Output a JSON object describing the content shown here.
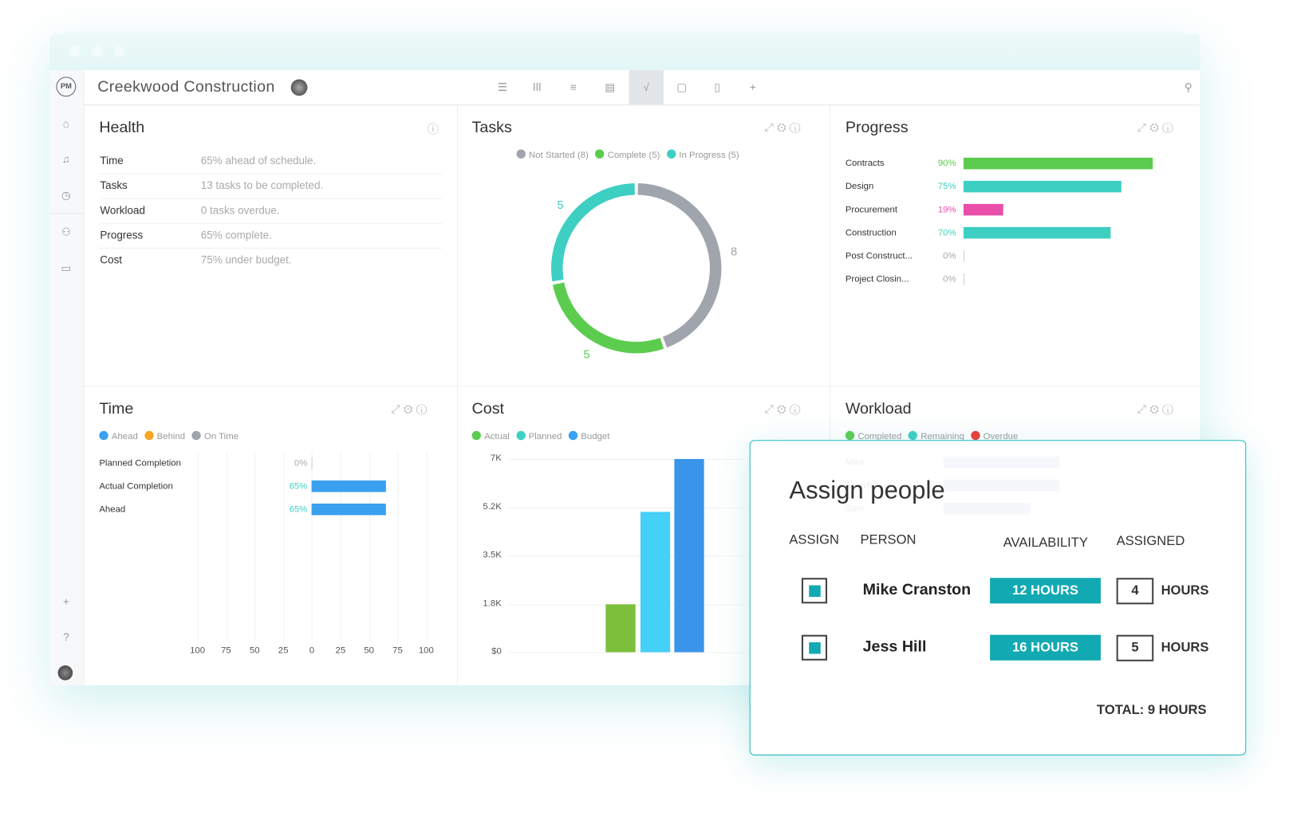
{
  "app": {
    "title": "Creekwood Construction",
    "logo": "PM"
  },
  "toolbar": {
    "icons": [
      "list-icon",
      "board-icon",
      "gantt-icon",
      "sheet-icon",
      "dashboard-icon",
      "calendar-icon",
      "file-icon",
      "plus-icon"
    ],
    "active": "dashboard-icon",
    "search": "search-icon"
  },
  "sidebar": {
    "icons": [
      "home-icon",
      "bell-icon",
      "clock-icon",
      "people-icon",
      "briefcase-icon",
      "plus-icon",
      "help-icon",
      "avatar"
    ]
  },
  "health": {
    "title": "Health",
    "rows": [
      {
        "label": "Time",
        "value": "65% ahead of schedule."
      },
      {
        "label": "Tasks",
        "value": "13 tasks to be completed."
      },
      {
        "label": "Workload",
        "value": "0 tasks overdue."
      },
      {
        "label": "Progress",
        "value": "65% complete."
      },
      {
        "label": "Cost",
        "value": "75% under budget."
      }
    ]
  },
  "tasks": {
    "title": "Tasks",
    "legend": [
      "Not Started (8)",
      "Complete (5)",
      "In Progress (5)"
    ]
  },
  "progress": {
    "title": "Progress"
  },
  "time": {
    "title": "Time",
    "legend": [
      "Ahead",
      "Behind",
      "On Time"
    ]
  },
  "cost": {
    "title": "Cost",
    "legend": [
      "Actual",
      "Planned",
      "Budget"
    ]
  },
  "workload": {
    "title": "Workload",
    "legend": [
      "Completed",
      "Remaining",
      "Overdue"
    ],
    "names": [
      "Mike",
      "Jennifer",
      "Sam"
    ]
  },
  "colors": {
    "teal": "#3ecfc3",
    "green": "#5ccc4e",
    "grey": "#a0a4ad",
    "pink": "#e94faa",
    "blue": "#3aa0f0",
    "accent": "#12a9b2"
  },
  "chart_data": [
    {
      "type": "pie",
      "title": "Tasks",
      "categories": [
        "Not Started",
        "Complete",
        "In Progress"
      ],
      "values": [
        8,
        5,
        5
      ],
      "colors": [
        "#a0a4ad",
        "#5ccc4e",
        "#3ecfc3"
      ],
      "labels": [
        "8",
        "5",
        "5"
      ]
    },
    {
      "type": "bar",
      "title": "Progress",
      "orientation": "horizontal",
      "categories": [
        "Contracts",
        "Design",
        "Procurement",
        "Construction",
        "Post Construct...",
        "Project Closin..."
      ],
      "values": [
        90,
        75,
        19,
        70,
        0,
        0
      ],
      "labels": [
        "90%",
        "75%",
        "19%",
        "70%",
        "0%",
        "0%"
      ],
      "colors": [
        "#5ccc4e",
        "#3ecfc3",
        "#e94faa",
        "#3ecfc3",
        "#3ecfc3",
        "#3ecfc3"
      ],
      "xlim": [
        0,
        100
      ]
    },
    {
      "type": "bar",
      "title": "Time",
      "orientation": "horizontal",
      "categories": [
        "Planned Completion",
        "Actual Completion",
        "Ahead"
      ],
      "values": [
        0,
        65,
        65
      ],
      "labels": [
        "0%",
        "65%",
        "65%"
      ],
      "xlim": [
        -100,
        100
      ],
      "xticks": [
        "100",
        "75",
        "50",
        "25",
        "0",
        "25",
        "50",
        "75",
        "100"
      ],
      "grid": true
    },
    {
      "type": "bar",
      "title": "Cost",
      "categories": [
        "Actual",
        "Planned",
        "Budget"
      ],
      "values": [
        1750,
        5100,
        7000
      ],
      "colors": [
        "#7cbf3a",
        "#45d0f7",
        "#3a95ea"
      ],
      "ylim": [
        0,
        7000
      ],
      "yticks": [
        "$0",
        "1.8K",
        "3.5K",
        "5.2K",
        "7K"
      ],
      "grid": true
    }
  ],
  "modal": {
    "title": "Assign people",
    "headers": [
      "ASSIGN",
      "PERSON",
      "AVAILABILITY",
      "ASSIGNED"
    ],
    "rows": [
      {
        "name": "Mike Cranston",
        "availability": "12 HOURS",
        "assigned": "4",
        "unit": "HOURS",
        "checked": true
      },
      {
        "name": "Jess Hill",
        "availability": "16 HOURS",
        "assigned": "5",
        "unit": "HOURS",
        "checked": true
      }
    ],
    "total": "TOTAL: 9 HOURS"
  }
}
